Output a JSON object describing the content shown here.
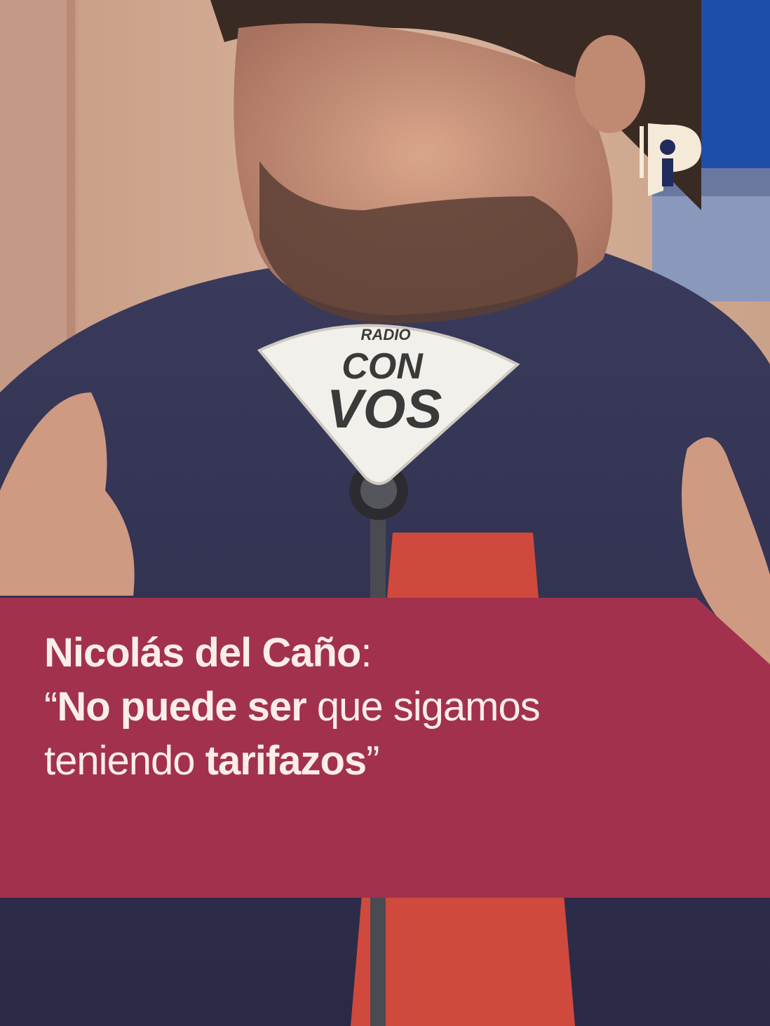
{
  "headline": {
    "line1": {
      "name": "Nicolás del Caño",
      "colon": ":"
    },
    "line2": {
      "open_quote": "“",
      "bold": "No puede ser",
      "rest": " que sigamos"
    },
    "line3": {
      "regular": "teniendo ",
      "bold": "tarifazos",
      "close_quote": "”"
    }
  },
  "microphone_label": {
    "top": "RADIO",
    "mid": "CON",
    "bottom": "VOS"
  },
  "colors": {
    "banner": "#a2314d",
    "banner_text": "#fbeee6",
    "logo": "#f5ead8"
  }
}
